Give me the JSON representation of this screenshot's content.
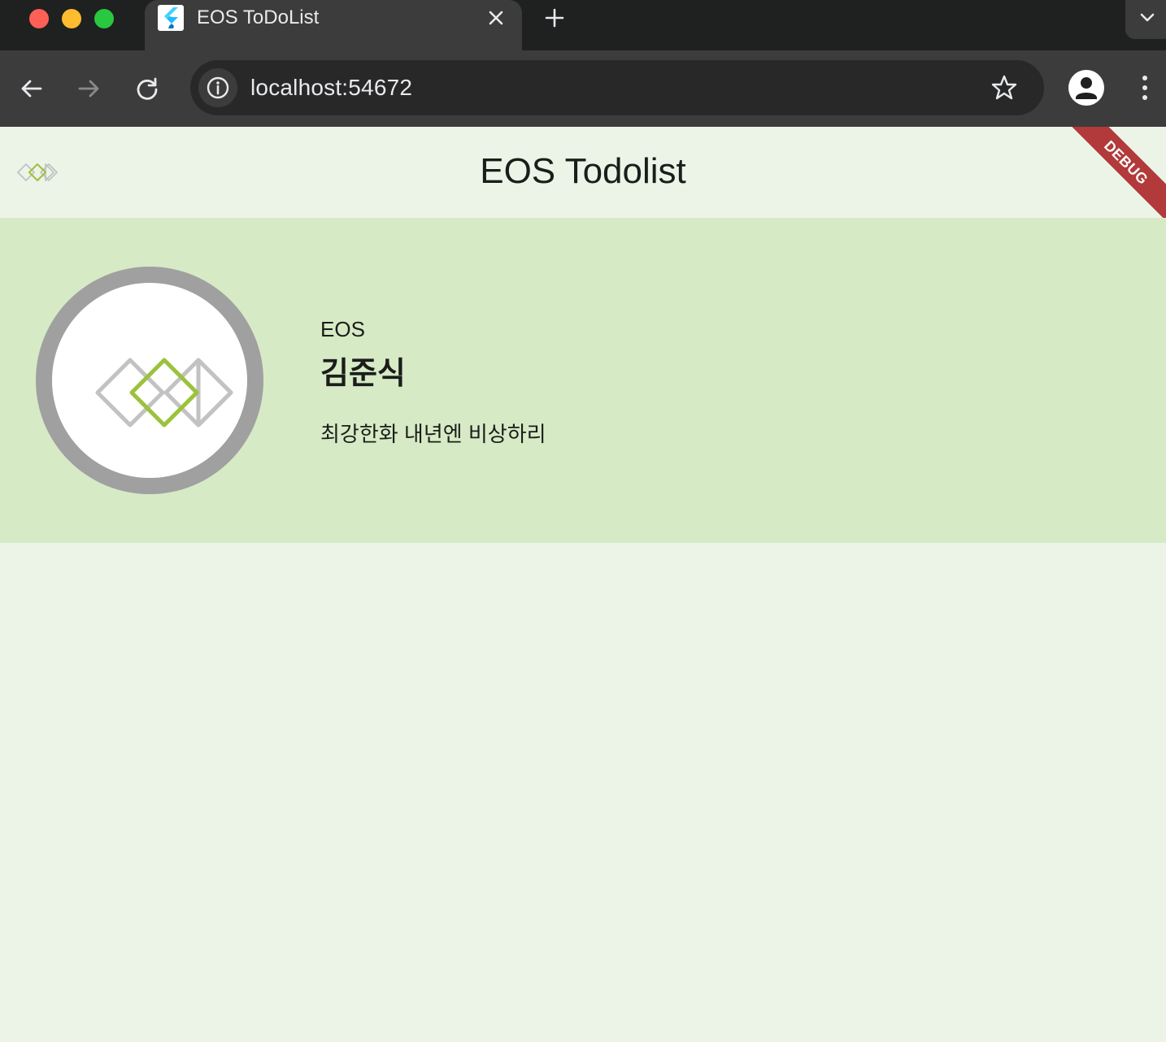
{
  "browser": {
    "tab": {
      "title": "EOS ToDoList",
      "favicon": "flutter-icon"
    },
    "address_bar": {
      "url": "localhost:54672"
    },
    "icons": {
      "back": "arrow-left-icon",
      "forward": "arrow-right-icon",
      "reload": "reload-icon",
      "site_info": "info-icon",
      "bookmark": "star-icon",
      "profile": "person-icon",
      "menu": "more-vert-icon",
      "tab_close": "close-icon",
      "new_tab": "plus-icon",
      "tab_search": "chevron-down-icon"
    }
  },
  "app": {
    "title": "EOS Todolist",
    "debug_banner": "DEBUG",
    "profile": {
      "organization": "EOS",
      "name": "김준식",
      "motto": "최강한화 내년엔 비상하리"
    }
  },
  "colors": {
    "app_background": "#ecf4e8",
    "profile_card": "#d6eac6",
    "logo_green": "#9bc23c",
    "logo_gray": "#c2c2c2",
    "avatar_ring": "#a0a0a0",
    "debug_banner": "#b23a3a"
  }
}
